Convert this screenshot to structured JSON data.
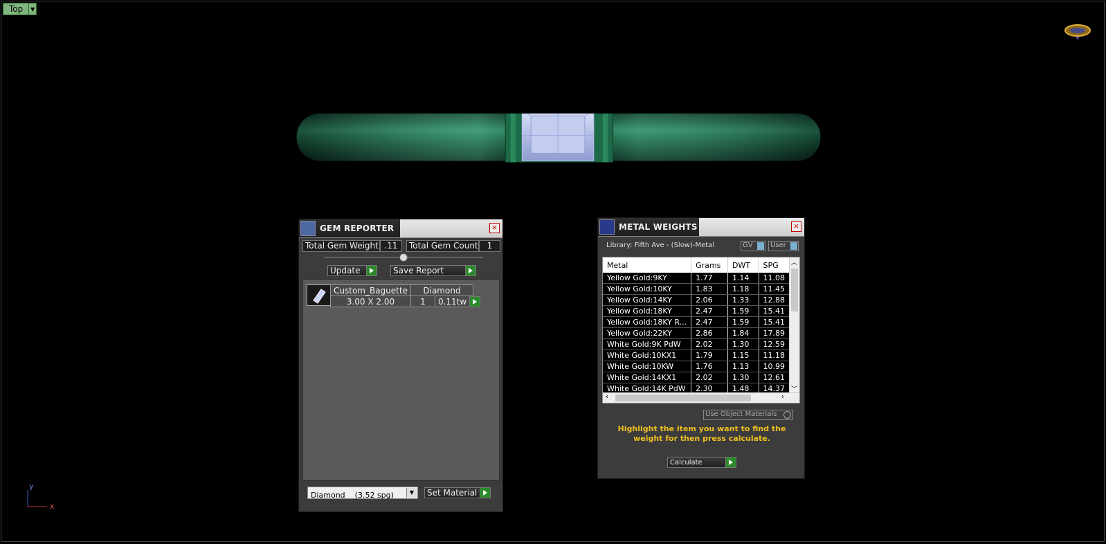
{
  "viewport": {
    "view_label": "Top",
    "axis_y": "y",
    "axis_x": "x"
  },
  "gem_reporter": {
    "title": "GEM REPORTER",
    "total_weight_label": "Total Gem Weight",
    "total_weight_value": ".11",
    "total_count_label": "Total Gem Count",
    "total_count_value": "1",
    "update_label": "Update",
    "save_report_label": "Save Report",
    "gems": [
      {
        "shape": "Custom_Baguette",
        "material": "Diamond",
        "size": "3.00 X 2.00",
        "count": "1",
        "weight": "0.11tw"
      }
    ],
    "material_select": "Diamond    (3.52 spg)",
    "set_material_label": "Set Material"
  },
  "metal_weights": {
    "title": "METAL WEIGHTS",
    "library": "Library: Fifth Ave - (Slow)-Metal",
    "gv_label": "GV",
    "user_label": "User",
    "columns": [
      "Metal",
      "Grams",
      "DWT",
      "SPG"
    ],
    "rows": [
      [
        "Yellow Gold:9KY",
        "1.77",
        "1.14",
        "11.08"
      ],
      [
        "Yellow Gold:10KY",
        "1.83",
        "1.18",
        "11.45"
      ],
      [
        "Yellow Gold:14KY",
        "2.06",
        "1.33",
        "12.88"
      ],
      [
        "Yellow Gold:18KY",
        "2.47",
        "1.59",
        "15.41"
      ],
      [
        "Yellow Gold:18KY R...",
        "2.47",
        "1.59",
        "15.41"
      ],
      [
        "Yellow Gold:22KY",
        "2.86",
        "1.84",
        "17.89"
      ],
      [
        "White Gold:9K PdW",
        "2.02",
        "1.30",
        "12.59"
      ],
      [
        "White Gold:10KX1",
        "1.79",
        "1.15",
        "11.18"
      ],
      [
        "White Gold:10KW",
        "1.76",
        "1.13",
        "10.99"
      ],
      [
        "White Gold:14KX1",
        "2.02",
        "1.30",
        "12.61"
      ],
      [
        "White Gold:14K PdW",
        "2.30",
        "1.48",
        "14.37"
      ]
    ],
    "use_object_materials_label": "Use Object Materials",
    "hint": "Highlight the item you want to find the weight for then press calculate.",
    "calculate_label": "Calculate"
  }
}
